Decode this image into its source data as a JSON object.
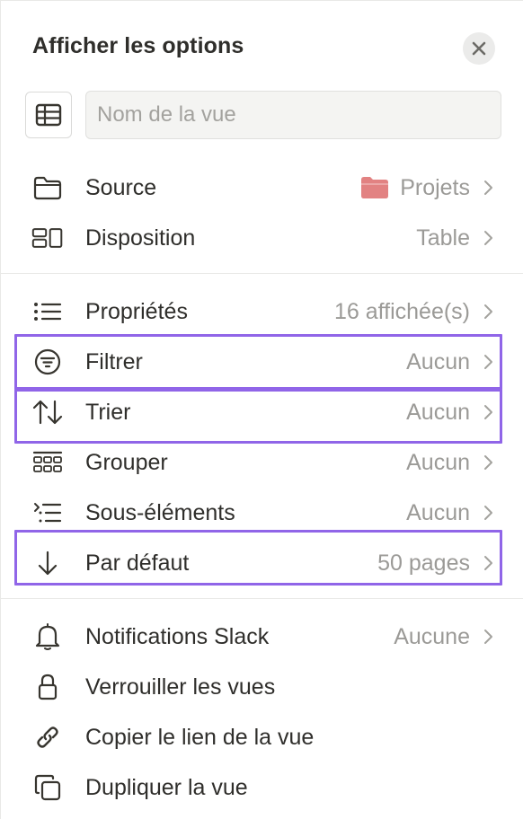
{
  "header": {
    "title": "Afficher les options"
  },
  "view_name": {
    "placeholder": "Nom de la vue",
    "value": ""
  },
  "menu": {
    "source": {
      "label": "Source",
      "value": "Projets",
      "value_icon_color": "#e28282"
    },
    "layout": {
      "label": "Disposition",
      "value": "Table"
    },
    "properties": {
      "label": "Propriétés",
      "value": "16 affichée(s)"
    },
    "filter": {
      "label": "Filtrer",
      "value": "Aucun"
    },
    "sort": {
      "label": "Trier",
      "value": "Aucun"
    },
    "group": {
      "label": "Grouper",
      "value": "Aucun"
    },
    "subitems": {
      "label": "Sous-éléments",
      "value": "Aucun"
    },
    "load_limit": {
      "label": "Par défaut",
      "value": "50 pages"
    },
    "slack": {
      "label": "Notifications Slack",
      "value": "Aucune"
    },
    "lock": {
      "label": "Verrouiller les vues"
    },
    "copy_link": {
      "label": "Copier le lien de la vue"
    },
    "duplicate": {
      "label": "Dupliquer la vue"
    }
  },
  "colors": {
    "highlight": "#9065e8",
    "text": "#2f2e2b",
    "muted": "#9b9a97"
  },
  "icons": [
    "close-icon",
    "table-icon",
    "folder-icon",
    "layout-icon",
    "list-icon",
    "filter-icon",
    "sort-icon",
    "grid-icon",
    "subitems-icon",
    "arrow-down-icon",
    "bell-icon",
    "lock-icon",
    "link-icon",
    "duplicate-icon",
    "chevron-right-icon"
  ]
}
